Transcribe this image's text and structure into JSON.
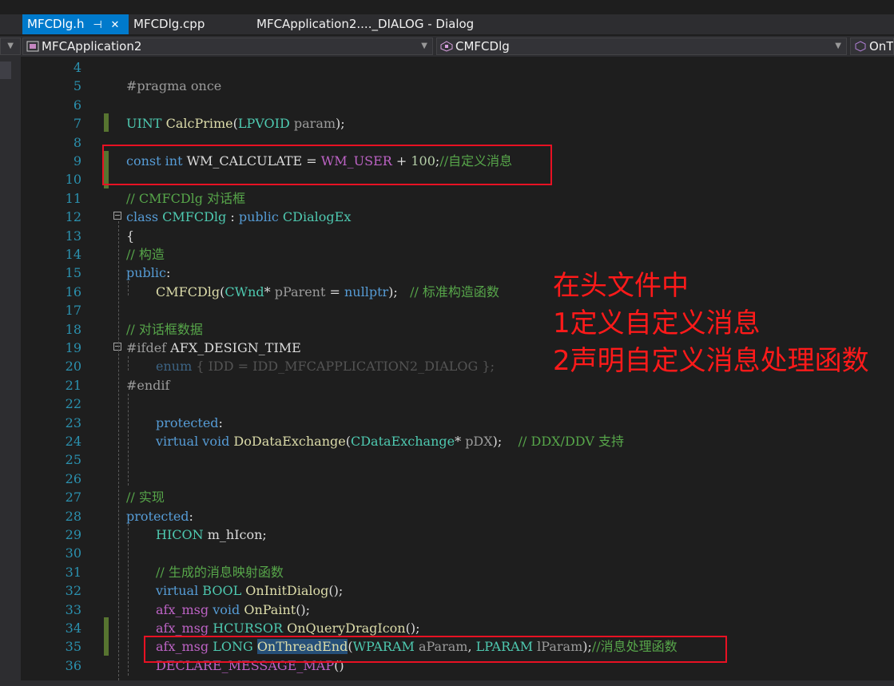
{
  "tabs": [
    {
      "label": "MFCDlg.h",
      "pin": "⊣",
      "close": "✕",
      "active": true
    },
    {
      "label": "MFCDlg.cpp",
      "active": false
    },
    {
      "label": "MFCApplication2...._DIALOG - Dialog",
      "active": false
    }
  ],
  "far_left_close": "✕",
  "nav": {
    "project": "MFCApplication2",
    "class": "CMFCDlg",
    "member": "OnT"
  },
  "line_numbers": [
    "4",
    "5",
    "6",
    "7",
    "8",
    "9",
    "10",
    "11",
    "12",
    "13",
    "14",
    "15",
    "16",
    "17",
    "18",
    "19",
    "20",
    "21",
    "22",
    "23",
    "24",
    "25",
    "26",
    "27",
    "28",
    "29",
    "30",
    "31",
    "32",
    "33",
    "34",
    "35",
    "36"
  ],
  "code": {
    "l5": {
      "pp": "#pragma once"
    },
    "l7": {
      "t1": "UINT",
      "fn": "CalcPrime",
      "p1": "(",
      "ty": "LPVOID",
      "pm": " param",
      "p2": ");"
    },
    "l9": {
      "k1": "const",
      "k2": "int",
      "id": " WM_CALCULATE = ",
      "mac": "WM_USER",
      "op": " + ",
      "num": "100",
      "semi": ";",
      "cm": "//自定义消息"
    },
    "l11": {
      "cm": "// CMFCDlg 对话框"
    },
    "l12": {
      "kw": "class",
      "ty": " CMFCDlg",
      "op": " : ",
      "kw2": "public",
      "ty2": " CDialogEx"
    },
    "l13": {
      "t": "{"
    },
    "l14": {
      "cm": "// 构造"
    },
    "l15": {
      "kw": "public",
      "t": ":"
    },
    "l16": {
      "fn": "CMFCDlg",
      "p1": "(",
      "ty": "CWnd",
      "op": "* ",
      "pm": "pParent",
      "eq": " = ",
      "kw": "nullptr",
      "p2": ");   ",
      "cm": "// 标准构造函数"
    },
    "l18": {
      "cm": "// 对话框数据"
    },
    "l19": {
      "pp": "#ifdef",
      "mac": " AFX_DESIGN_TIME"
    },
    "l20": {
      "kw": "enum",
      "t": " { IDD = IDD_MFCAPPLICATION2_DIALOG };"
    },
    "l21": {
      "pp": "#endif"
    },
    "l23": {
      "kw": "protected",
      "t": ":"
    },
    "l24": {
      "kw": "virtual",
      "kw2": " void",
      "fn": " DoDataExchange",
      "p1": "(",
      "ty": "CDataExchange",
      "op": "* ",
      "pm": "pDX",
      "p2": ");    ",
      "cm": "// DDX/DDV 支持"
    },
    "l27": {
      "cm": "// 实现"
    },
    "l28": {
      "kw": "protected",
      "t": ":"
    },
    "l29": {
      "ty": "HICON",
      "id": " m_hIcon;"
    },
    "l31": {
      "cm": "// 生成的消息映射函数"
    },
    "l32": {
      "kw": "virtual",
      "ty": " BOOL",
      "fn": " OnInitDialog",
      "t": "();"
    },
    "l33": {
      "mac": "afx_msg",
      "kw": " void",
      "fn": " OnPaint",
      "t": "();"
    },
    "l34": {
      "mac": "afx_msg",
      "ty": " HCURSOR",
      "fn": " OnQueryDragIcon",
      "t": "();"
    },
    "l35": {
      "mac": "afx_msg",
      "ty": " LONG",
      "sp": " ",
      "fn_hl": "OnThreadEnd",
      "p1": "(",
      "ty2": "WPARAM",
      "pm": " aParam",
      "c1": ", ",
      "ty3": "LPARAM",
      "pm2": " lParam",
      "p2": ");",
      "cm": "//消息处理函数"
    },
    "l36": {
      "mac": "DECLARE_MESSAGE_MAP",
      "t": "()"
    }
  },
  "annotation": {
    "line1": "在头文件中",
    "line2": "1定义自定义消息",
    "line3": "2声明自定义消息处理函数"
  },
  "colors": {
    "accent": "#007acc",
    "annotation": "#ff1a1a",
    "change_bar": "#577430"
  }
}
